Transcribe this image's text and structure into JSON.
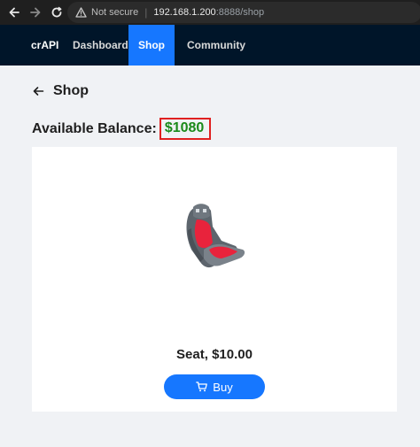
{
  "browser": {
    "security_label": "Not secure",
    "url_host": "192.168.1.200",
    "url_path": ":8888/shop"
  },
  "header": {
    "brand": "crAPI",
    "nav": [
      "Dashboard",
      "Shop",
      "Community"
    ],
    "active": "Shop",
    "bg_color": "#001529",
    "accent_color": "#1677ff"
  },
  "page": {
    "title": "Shop",
    "balance_label": "Available Balance",
    "balance_separator": ":",
    "balance_value": "$1080",
    "balance_color": "#1a8a1a",
    "highlight_color": "#e02020"
  },
  "products": [
    {
      "name": "Seat, $10.00",
      "image_icon": "car-seat-image",
      "buy_label": "Buy",
      "buy_icon": "cart-icon"
    }
  ]
}
